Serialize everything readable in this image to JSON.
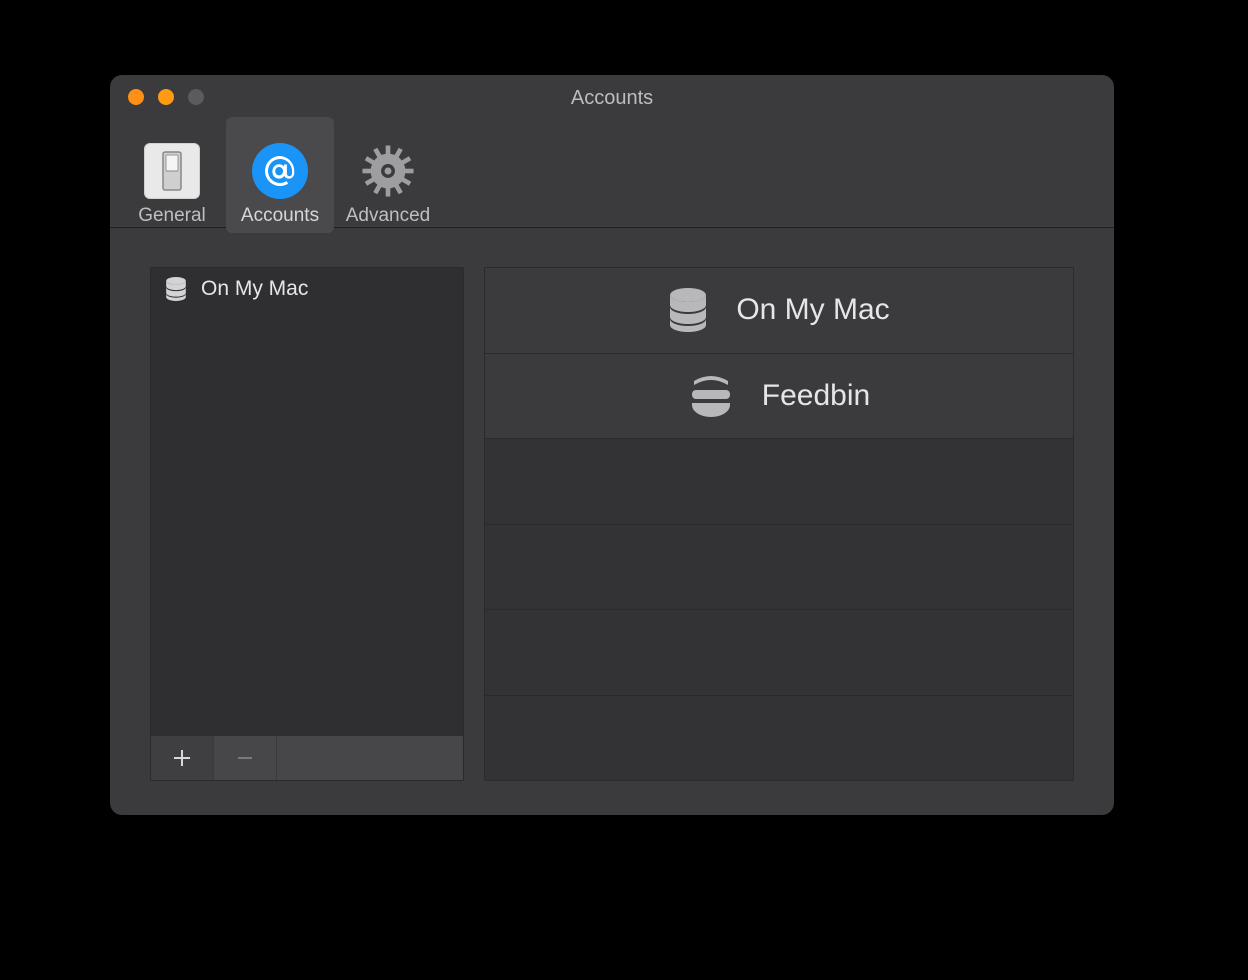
{
  "window": {
    "title": "Accounts"
  },
  "toolbar": {
    "tabs": [
      {
        "label": "General",
        "selected": false,
        "icon": "switch"
      },
      {
        "label": "Accounts",
        "selected": true,
        "icon": "at"
      },
      {
        "label": "Advanced",
        "selected": false,
        "icon": "gear"
      }
    ]
  },
  "sidebar": {
    "items": [
      {
        "label": "On My Mac",
        "icon": "database"
      }
    ],
    "add_label": "+",
    "remove_label": "−"
  },
  "account_types": [
    {
      "label": "On My Mac",
      "icon": "database"
    },
    {
      "label": "Feedbin",
      "icon": "feedbin"
    },
    {
      "label": "",
      "icon": ""
    },
    {
      "label": "",
      "icon": ""
    },
    {
      "label": "",
      "icon": ""
    },
    {
      "label": "",
      "icon": ""
    }
  ]
}
